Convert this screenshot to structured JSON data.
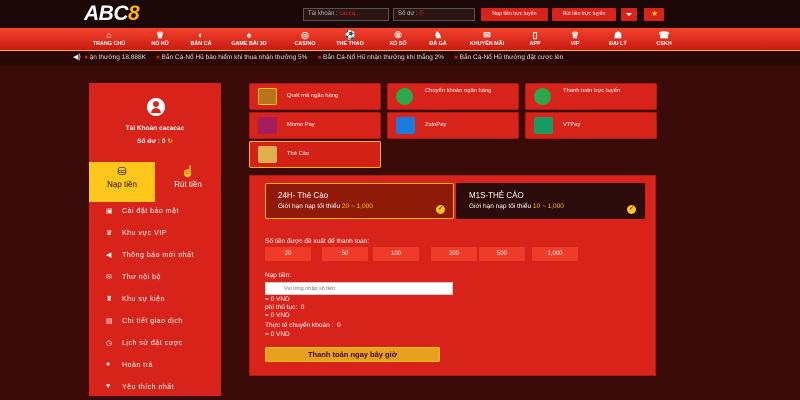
{
  "brand": {
    "logo_prefix": "ABC",
    "logo_suffix": "8"
  },
  "topbar": {
    "account_label": "Tài khoản :",
    "account_value": "cacca...",
    "balance_label": "Số dư :",
    "balance_value": "0",
    "deposit_button": "Nạp tiền trực tuyến",
    "withdraw_button": "Rút tiền trực tuyến"
  },
  "nav": {
    "items": [
      {
        "label": "TRANG CHỦ",
        "icon": "home-icon",
        "glyph": "⌂"
      },
      {
        "label": "NỔ HŨ",
        "icon": "slot-icon",
        "glyph": "♛"
      },
      {
        "label": "BẮN CÁ",
        "icon": "fish-icon",
        "glyph": "◐"
      },
      {
        "label": "GAME BÀI 3D",
        "icon": "cards-icon",
        "glyph": "♠"
      },
      {
        "label": "CASINO",
        "icon": "casino-icon",
        "glyph": "◎"
      },
      {
        "label": "THỂ THAO",
        "icon": "sports-icon",
        "glyph": "⚽"
      },
      {
        "label": "XỔ SỐ",
        "icon": "lottery-icon",
        "glyph": "⑧"
      },
      {
        "label": "ĐÁ GÀ",
        "icon": "rooster-icon",
        "glyph": "♞"
      },
      {
        "label": "KHUYẾN MÃI",
        "icon": "promo-icon",
        "glyph": "✉"
      },
      {
        "label": "APP",
        "icon": "app-icon",
        "glyph": "▯"
      },
      {
        "label": "VIP",
        "icon": "vip-icon",
        "glyph": "♕"
      },
      {
        "label": "ĐẠI LÝ",
        "icon": "agent-icon",
        "glyph": "☗"
      },
      {
        "label": "CSKH",
        "icon": "support-icon",
        "glyph": "☎"
      }
    ]
  },
  "marquee": {
    "items": [
      "ận thưởng 18.888K",
      "Bắn Cá-Nổ Hũ bảo hiểm khi thua nhận thưởng 5%",
      "Bắn Cá-Nổ Hũ nhận thưởng khi thắng 2%",
      "Bắn Cá-Nổ Hũ thưởng đặt cược lên"
    ]
  },
  "sidebar": {
    "account_name": "Tài Khoản cacacac",
    "balance_label": "Số dư :",
    "balance_value": "0",
    "deposit_tab": "Nạp tiền",
    "withdraw_tab": "Rút tiền",
    "menu": [
      {
        "label": "Cài đặt bảo mật",
        "icon": "lock-icon",
        "glyph": "▣"
      },
      {
        "label": "Khu vực VIP",
        "icon": "crown-icon",
        "glyph": "♛"
      },
      {
        "label": "Thông báo mới nhất",
        "icon": "megaphone-icon",
        "glyph": "◀"
      },
      {
        "label": "Thư nội bộ",
        "icon": "mail-icon",
        "glyph": "✉"
      },
      {
        "label": "Khu sự kiện",
        "icon": "trophy-icon",
        "glyph": "♜"
      },
      {
        "label": "Chi tiết giao dịch",
        "icon": "receipt-icon",
        "glyph": "▤"
      },
      {
        "label": "Lịch sử đặt cược",
        "icon": "history-icon",
        "glyph": "◷"
      },
      {
        "label": "Hoàn trả",
        "icon": "refund-icon",
        "glyph": "●"
      },
      {
        "label": "Yêu thích nhất",
        "icon": "heart-icon",
        "glyph": "♥"
      }
    ]
  },
  "payment_methods": [
    {
      "label": "Quét mã ngân hàng",
      "icon": "qr-code-icon"
    },
    {
      "label": "Chuyển khoản ngân hàng",
      "icon": "globe-bank-icon"
    },
    {
      "label": "Thanh toán trực tuyến",
      "icon": "globe-online-icon"
    },
    {
      "label": "Momo Pay",
      "icon": "momo-icon"
    },
    {
      "label": "ZaloPay",
      "icon": "zalopay-icon"
    },
    {
      "label": "VTPay",
      "icon": "vtpay-icon"
    },
    {
      "label": "Thẻ Cào",
      "icon": "scratch-card-icon"
    }
  ],
  "cards": {
    "selected": {
      "name": "24H- Thẻ Cào",
      "limit_label": "Giới hạn nạp tối thiểu",
      "limit_value": "20 ~ 1,000"
    },
    "other": {
      "name": "M1S-THẺ CÀO",
      "limit_label": "Giới hạn nạp tối thiểu",
      "limit_value": "10 ~ 1,000"
    }
  },
  "form": {
    "suggest_label": "Số tiền được đề xuất để thanh toán:",
    "amounts": [
      "20",
      "50",
      "100",
      "200",
      "500",
      "1,000"
    ],
    "deposit_label": "Nạp tiền:",
    "deposit_placeholder": "Vui lòng nhập số tiền",
    "deposit_converted": "= 0 VND",
    "fee_label": "phí thủ tục:",
    "fee_value": "0",
    "fee_converted": "= 0 VND",
    "actual_label": "Thực tế chuyển khoản :",
    "actual_value": "0",
    "actual_converted": "= 0 VND",
    "pay_button": "Thanh toán ngay bây giờ"
  }
}
